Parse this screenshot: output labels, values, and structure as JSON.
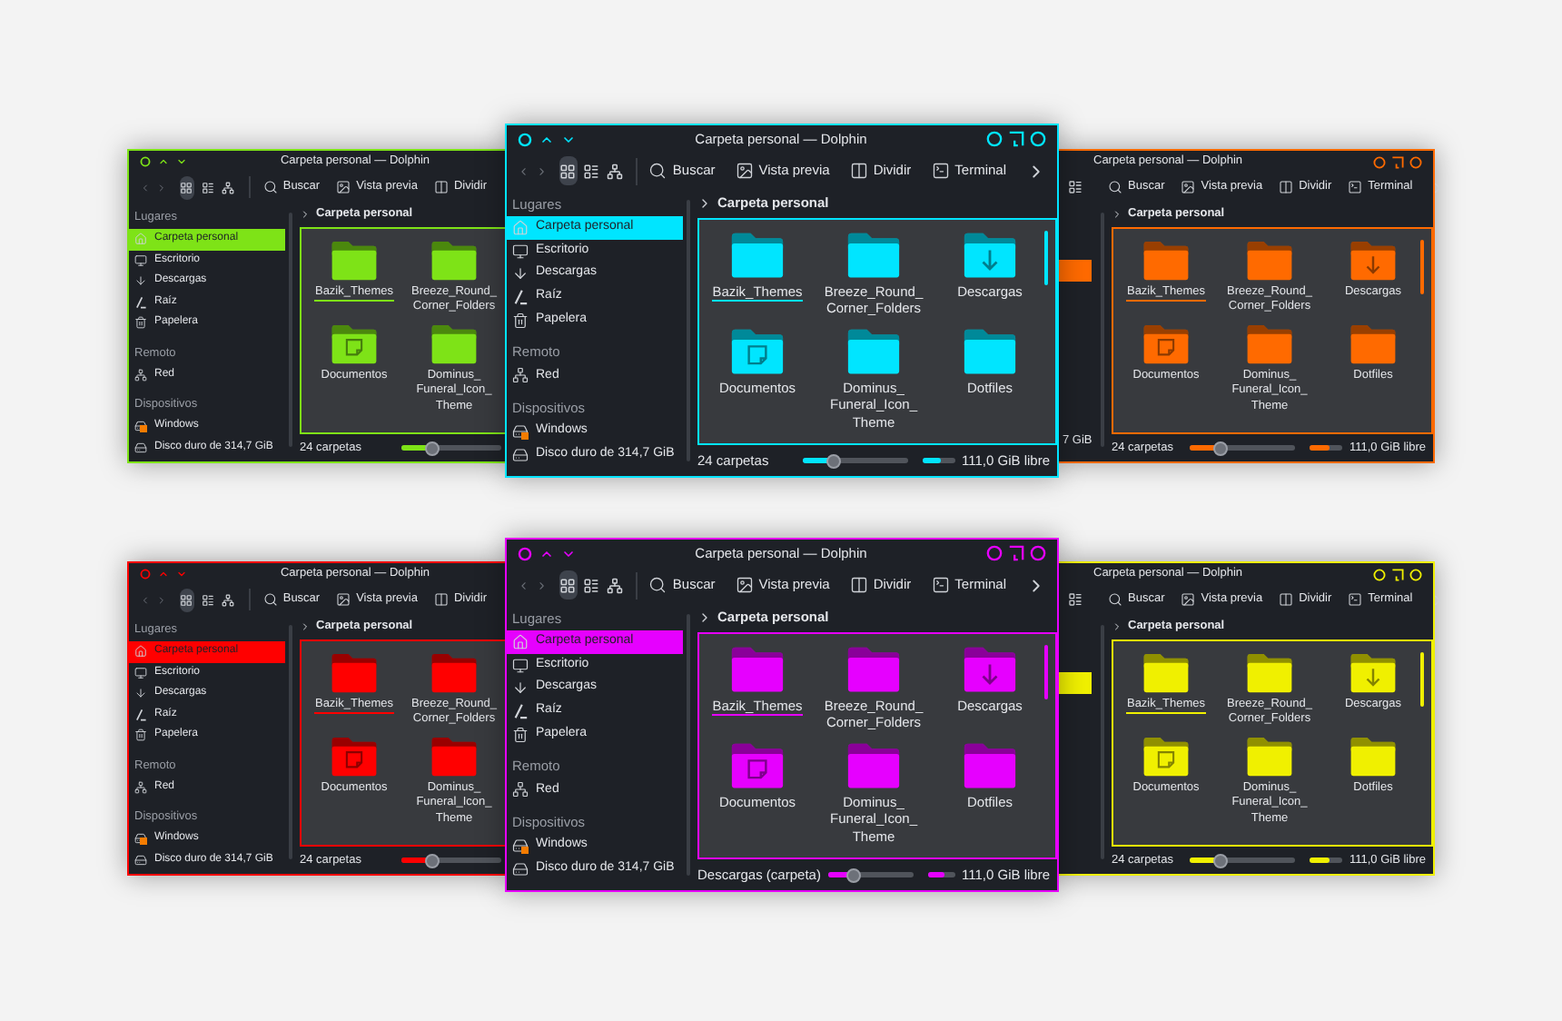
{
  "windows": [
    {
      "kind": "left",
      "color": "#7ee317",
      "title": "Carpeta personal — Dolphin",
      "view_modes": [
        {
          "selected": true
        },
        {
          "selected": false
        },
        {
          "selected": false
        }
      ],
      "actions": [
        {
          "label": "Buscar",
          "kind": "search"
        },
        {
          "label": "Vista previa",
          "kind": "preview"
        },
        {
          "label": "Dividir",
          "kind": "split"
        }
      ],
      "sidebar": [
        {
          "heading": "Lugares",
          "items": [
            {
              "label": "Carpeta personal",
              "kind": "home",
              "selected": true
            },
            {
              "label": "Escritorio",
              "kind": "desktop",
              "selected": false
            },
            {
              "label": "Descargas",
              "kind": "download",
              "selected": false
            },
            {
              "label": "Raíz",
              "kind": "root",
              "selected": false
            },
            {
              "label": "Papelera",
              "kind": "trash",
              "selected": false
            }
          ]
        },
        {
          "heading": "Remoto",
          "items": [
            {
              "label": "Red",
              "kind": "network",
              "selected": false
            }
          ]
        },
        {
          "heading": "Dispositivos",
          "items": [
            {
              "label": "Windows",
              "kind": "drive",
              "selected": false
            },
            {
              "label": "Disco duro de 314,7 GiB",
              "kind": "disk",
              "selected": false
            }
          ]
        }
      ],
      "breadcrumb": "Carpeta personal",
      "folders": [
        {
          "name": "Bazik_Themes",
          "kind": "plain",
          "selected": true
        },
        {
          "name": "Breeze_Round_Corner_Folders",
          "kind": "plain",
          "selected": false
        },
        {
          "name": "Documentos",
          "kind": "documents",
          "selected": false
        },
        {
          "name": "Dominus_Funeral_Icon_Theme",
          "kind": "plain",
          "selected": false
        }
      ],
      "status": "24 carpetas",
      "zoom": {
        "level": 0.3
      }
    },
    {
      "kind": "center",
      "color": "#00e5ff",
      "title": "Carpeta personal — Dolphin",
      "view_modes": [
        {
          "selected": true
        },
        {
          "selected": false
        },
        {
          "selected": false
        }
      ],
      "actions": [
        {
          "label": "Buscar",
          "kind": "search"
        },
        {
          "label": "Vista previa",
          "kind": "preview"
        },
        {
          "label": "Dividir",
          "kind": "split"
        },
        {
          "label": "Terminal",
          "kind": "terminal"
        }
      ],
      "sidebar": [
        {
          "heading": "Lugares",
          "items": [
            {
              "label": "Carpeta personal",
              "kind": "home",
              "selected": true
            },
            {
              "label": "Escritorio",
              "kind": "desktop",
              "selected": false
            },
            {
              "label": "Descargas",
              "kind": "download",
              "selected": false
            },
            {
              "label": "Raíz",
              "kind": "root",
              "selected": false
            },
            {
              "label": "Papelera",
              "kind": "trash",
              "selected": false
            }
          ]
        },
        {
          "heading": "Remoto",
          "items": [
            {
              "label": "Red",
              "kind": "network",
              "selected": false
            }
          ]
        },
        {
          "heading": "Dispositivos",
          "items": [
            {
              "label": "Windows",
              "kind": "drive",
              "selected": false
            },
            {
              "label": "Disco duro de 314,7 GiB",
              "kind": "disk",
              "selected": false
            }
          ]
        }
      ],
      "breadcrumb": "Carpeta personal",
      "folders": [
        {
          "name": "Bazik_Themes",
          "kind": "plain",
          "selected": true
        },
        {
          "name": "Breeze_Round_Corner_Folders",
          "kind": "plain",
          "selected": false
        },
        {
          "name": "Descargas",
          "kind": "downloads",
          "selected": false
        },
        {
          "name": "Documentos",
          "kind": "documents",
          "selected": false
        },
        {
          "name": "Dominus_Funeral_Icon_Theme",
          "kind": "plain",
          "selected": false
        },
        {
          "name": "Dotfiles",
          "kind": "plain",
          "selected": false
        }
      ],
      "status": "24 carpetas",
      "zoom": {
        "level": 0.3
      },
      "free_space": {
        "level": 0.6,
        "text": "111,0 GiB libre"
      }
    },
    {
      "kind": "right",
      "color": "#ff6a00",
      "title": "Carpeta personal — Dolphin",
      "sidebar_highlight": true,
      "sidebar_cut_text": "7 GiB",
      "actions": [
        {
          "label": "Buscar",
          "kind": "search"
        },
        {
          "label": "Vista previa",
          "kind": "preview"
        },
        {
          "label": "Dividir",
          "kind": "split"
        },
        {
          "label": "Terminal",
          "kind": "terminal"
        }
      ],
      "breadcrumb": "Carpeta personal",
      "folders": [
        {
          "name": "Bazik_Themes",
          "kind": "plain",
          "selected": true
        },
        {
          "name": "Breeze_Round_Corner_Folders",
          "kind": "plain",
          "selected": false
        },
        {
          "name": "Descargas",
          "kind": "downloads",
          "selected": false
        },
        {
          "name": "Documentos",
          "kind": "documents",
          "selected": false
        },
        {
          "name": "Dominus_Funeral_Icon_Theme",
          "kind": "plain",
          "selected": false
        },
        {
          "name": "Dotfiles",
          "kind": "plain",
          "selected": false
        }
      ],
      "status": "24 carpetas",
      "zoom": {
        "level": 0.3
      },
      "free_space": {
        "level": 0.6,
        "text": "111,0 GiB libre"
      }
    },
    {
      "kind": "left",
      "color": "#ff0000",
      "title": "Carpeta personal — Dolphin",
      "view_modes": [
        {
          "selected": true
        },
        {
          "selected": false
        },
        {
          "selected": false
        }
      ],
      "actions": [
        {
          "label": "Buscar",
          "kind": "search"
        },
        {
          "label": "Vista previa",
          "kind": "preview"
        },
        {
          "label": "Dividir",
          "kind": "split"
        }
      ],
      "sidebar": [
        {
          "heading": "Lugares",
          "items": [
            {
              "label": "Carpeta personal",
              "kind": "home",
              "selected": true
            },
            {
              "label": "Escritorio",
              "kind": "desktop",
              "selected": false
            },
            {
              "label": "Descargas",
              "kind": "download",
              "selected": false
            },
            {
              "label": "Raíz",
              "kind": "root",
              "selected": false
            },
            {
              "label": "Papelera",
              "kind": "trash",
              "selected": false
            }
          ]
        },
        {
          "heading": "Remoto",
          "items": [
            {
              "label": "Red",
              "kind": "network",
              "selected": false
            }
          ]
        },
        {
          "heading": "Dispositivos",
          "items": [
            {
              "label": "Windows",
              "kind": "drive",
              "selected": false
            },
            {
              "label": "Disco duro de 314,7 GiB",
              "kind": "disk",
              "selected": false
            }
          ]
        }
      ],
      "breadcrumb": "Carpeta personal",
      "folders": [
        {
          "name": "Bazik_Themes",
          "kind": "plain",
          "selected": true
        },
        {
          "name": "Breeze_Round_Corner_Folders",
          "kind": "plain",
          "selected": false
        },
        {
          "name": "Documentos",
          "kind": "documents",
          "selected": false
        },
        {
          "name": "Dominus_Funeral_Icon_Theme",
          "kind": "plain",
          "selected": false
        }
      ],
      "status": "24 carpetas",
      "zoom": {
        "level": 0.3
      }
    },
    {
      "kind": "center",
      "color": "#e600ff",
      "title": "Carpeta personal — Dolphin",
      "view_modes": [
        {
          "selected": true
        },
        {
          "selected": false
        },
        {
          "selected": false
        }
      ],
      "actions": [
        {
          "label": "Buscar",
          "kind": "search"
        },
        {
          "label": "Vista previa",
          "kind": "preview"
        },
        {
          "label": "Dividir",
          "kind": "split"
        },
        {
          "label": "Terminal",
          "kind": "terminal"
        }
      ],
      "sidebar": [
        {
          "heading": "Lugares",
          "items": [
            {
              "label": "Carpeta personal",
              "kind": "home",
              "selected": true
            },
            {
              "label": "Escritorio",
              "kind": "desktop",
              "selected": false
            },
            {
              "label": "Descargas",
              "kind": "download",
              "selected": false
            },
            {
              "label": "Raíz",
              "kind": "root",
              "selected": false
            },
            {
              "label": "Papelera",
              "kind": "trash",
              "selected": false
            }
          ]
        },
        {
          "heading": "Remoto",
          "items": [
            {
              "label": "Red",
              "kind": "network",
              "selected": false
            }
          ]
        },
        {
          "heading": "Dispositivos",
          "items": [
            {
              "label": "Windows",
              "kind": "drive",
              "selected": false
            },
            {
              "label": "Disco duro de 314,7 GiB",
              "kind": "disk",
              "selected": false
            }
          ]
        }
      ],
      "breadcrumb": "Carpeta personal",
      "folders": [
        {
          "name": "Bazik_Themes",
          "kind": "plain",
          "selected": true
        },
        {
          "name": "Breeze_Round_Corner_Folders",
          "kind": "plain",
          "selected": false
        },
        {
          "name": "Descargas",
          "kind": "downloads",
          "selected": false
        },
        {
          "name": "Documentos",
          "kind": "documents",
          "selected": false
        },
        {
          "name": "Dominus_Funeral_Icon_Theme",
          "kind": "plain",
          "selected": false
        },
        {
          "name": "Dotfiles",
          "kind": "plain",
          "selected": false
        }
      ],
      "status": "Descargas (carpeta)",
      "zoom": {
        "level": 0.3
      },
      "free_space": {
        "level": 0.6,
        "text": "111,0 GiB libre"
      }
    },
    {
      "kind": "right",
      "color": "#f0f000",
      "title": "Carpeta personal — Dolphin",
      "sidebar_highlight": true,
      "actions": [
        {
          "label": "Buscar",
          "kind": "search"
        },
        {
          "label": "Vista previa",
          "kind": "preview"
        },
        {
          "label": "Dividir",
          "kind": "split"
        },
        {
          "label": "Terminal",
          "kind": "terminal"
        }
      ],
      "breadcrumb": "Carpeta personal",
      "folders": [
        {
          "name": "Bazik_Themes",
          "kind": "plain",
          "selected": true
        },
        {
          "name": "Breeze_Round_Corner_Folders",
          "kind": "plain",
          "selected": false
        },
        {
          "name": "Descargas",
          "kind": "downloads",
          "selected": false
        },
        {
          "name": "Documentos",
          "kind": "documents",
          "selected": false
        },
        {
          "name": "Dominus_Funeral_Icon_Theme",
          "kind": "plain",
          "selected": false
        },
        {
          "name": "Dotfiles",
          "kind": "plain",
          "selected": false
        }
      ],
      "status": "24 carpetas",
      "zoom": {
        "level": 0.3
      },
      "free_space": {
        "level": 0.6,
        "text": "111,0 GiB libre"
      }
    }
  ]
}
